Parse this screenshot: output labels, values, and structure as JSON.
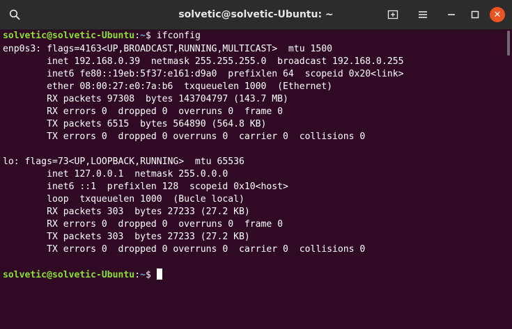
{
  "window": {
    "title": "solvetic@solvetic-Ubuntu: ~",
    "close_glyph": "✕"
  },
  "prompt": {
    "user_host": "solvetic@solvetic-Ubuntu",
    "separator": ":",
    "path": "~",
    "symbol": "$ ",
    "command": "ifconfig"
  },
  "output": [
    "enp0s3: flags=4163<UP,BROADCAST,RUNNING,MULTICAST>  mtu 1500",
    "        inet 192.168.0.39  netmask 255.255.255.0  broadcast 192.168.0.255",
    "        inet6 fe80::19eb:5f37:e161:d9a0  prefixlen 64  scopeid 0x20<link>",
    "        ether 08:00:27:e0:7a:b6  txqueuelen 1000  (Ethernet)",
    "        RX packets 97308  bytes 143704797 (143.7 MB)",
    "        RX errors 0  dropped 0  overruns 0  frame 0",
    "        TX packets 6515  bytes 564890 (564.8 KB)",
    "        TX errors 0  dropped 0 overruns 0  carrier 0  collisions 0",
    "",
    "lo: flags=73<UP,LOOPBACK,RUNNING>  mtu 65536",
    "        inet 127.0.0.1  netmask 255.0.0.0",
    "        inet6 ::1  prefixlen 128  scopeid 0x10<host>",
    "        loop  txqueuelen 1000  (Bucle local)",
    "        RX packets 303  bytes 27233 (27.2 KB)",
    "        RX errors 0  dropped 0  overruns 0  frame 0",
    "        TX packets 303  bytes 27233 (27.2 KB)",
    "        TX errors 0  dropped 0 overruns 0  carrier 0  collisions 0",
    ""
  ],
  "colors": {
    "background": "#300a24",
    "titlebar": "#2c2c2c",
    "user_host": "#8ae234",
    "path": "#729fcf",
    "text": "#ffffff",
    "close_button": "#e95420"
  },
  "icons": {
    "search": "search-icon",
    "new_tab": "new-tab-icon",
    "menu": "hamburger-menu-icon",
    "minimize": "minimize-icon",
    "maximize": "maximize-icon",
    "close": "close-icon"
  }
}
